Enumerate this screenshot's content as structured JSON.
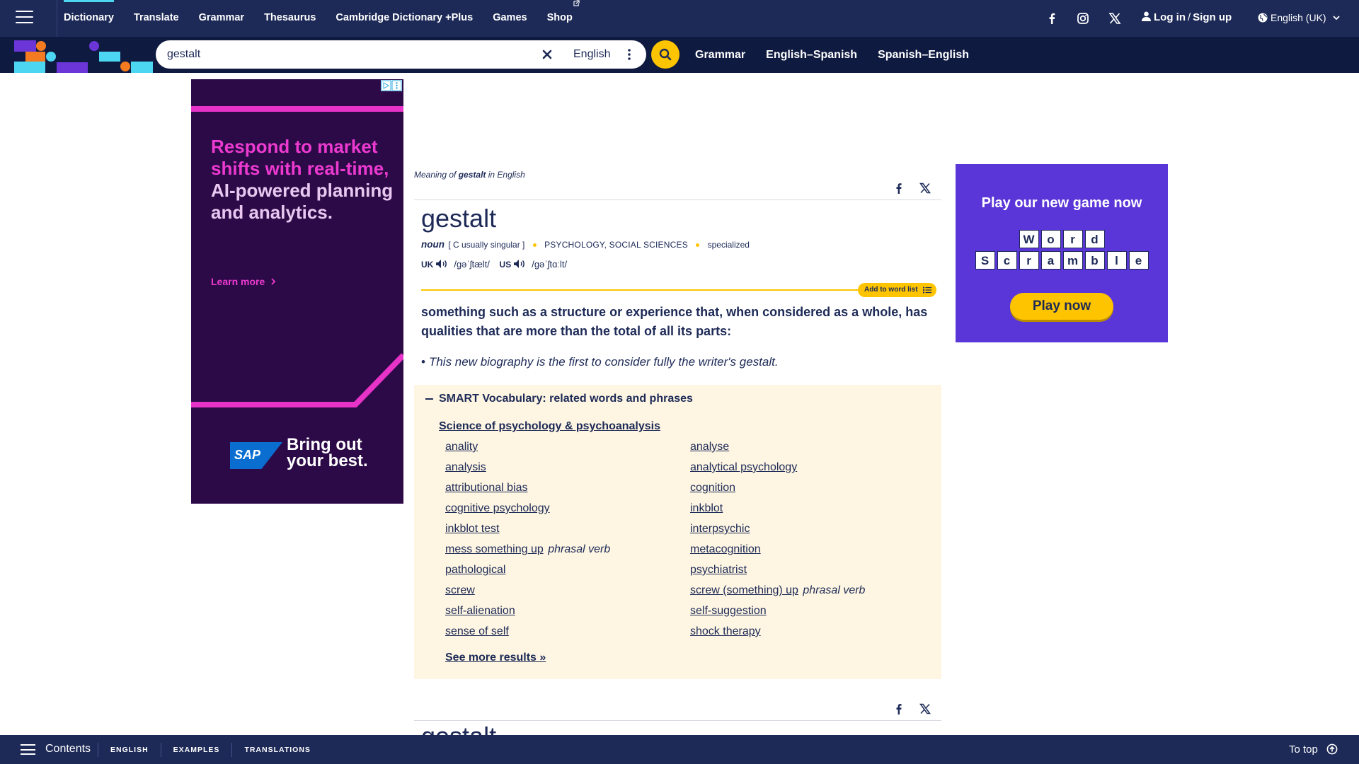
{
  "nav": {
    "items": [
      {
        "label": "Dictionary",
        "active": true
      },
      {
        "label": "Translate"
      },
      {
        "label": "Grammar"
      },
      {
        "label": "Thesaurus"
      },
      {
        "label": "Cambridge Dictionary +Plus"
      },
      {
        "label": "Games"
      },
      {
        "label": "Shop"
      }
    ],
    "login_label": "Log in",
    "slash": "/",
    "signup_label": "Sign up",
    "language": "English (UK)",
    "icons": [
      "menu-icon",
      "facebook-icon",
      "instagram-icon",
      "x-icon",
      "user-icon",
      "globe-icon",
      "chevron-down-icon",
      "external-link-icon"
    ]
  },
  "search": {
    "value": "gestalt",
    "dictionary": "English",
    "links": [
      "Grammar",
      "English–Spanish",
      "Spanish–English"
    ]
  },
  "ad_left": {
    "headline_1": "Respond to market shifts with real-time,",
    "headline_2": "AI-powered planning and analytics.",
    "learn_more": "Learn more",
    "brand": "SAP",
    "tagline_1": "Bring out",
    "tagline_2": "your best."
  },
  "ad_right": {
    "title": "Play our new game now",
    "row1": [
      "W",
      "o",
      "r",
      "d"
    ],
    "row2": [
      "S",
      "c",
      "r",
      "a",
      "m",
      "b",
      "l",
      "e"
    ],
    "button": "Play now"
  },
  "entry": {
    "meaning_prefix": "Meaning of ",
    "meaning_word": "gestalt",
    "meaning_suffix": " in English",
    "headword": "gestalt",
    "pos": "noun",
    "grammar": "[ C usually singular ]",
    "domain_1": "PSYCHOLOGY",
    "domain_sep": ", ",
    "domain_2": "SOCIAL SCIENCES",
    "usage": "specialized",
    "uk_label": "UK",
    "uk_ipa": "/ɡəˈʃtælt/",
    "us_label": "US",
    "us_ipa": "/ɡəˈʃtɑːlt/",
    "add_to_word_list": "Add to word list",
    "definition": "something such as a structure or experience that, when considered as a whole, has qualities that are more than the total of all its parts:",
    "example": "This new biography is the first to consider fully the writer's gestalt."
  },
  "smart_vocab": {
    "title": "SMART Vocabulary: related words and phrases",
    "topic": "Science of psychology & psychoanalysis",
    "col1": [
      {
        "word": "anality"
      },
      {
        "word": "analysis"
      },
      {
        "word": "attributional bias"
      },
      {
        "word": "cognitive psychology"
      },
      {
        "word": "inkblot test"
      },
      {
        "word": "mess something up",
        "note": "phrasal verb"
      },
      {
        "word": "pathological"
      },
      {
        "word": "screw"
      },
      {
        "word": "self-alienation"
      },
      {
        "word": "sense of self"
      }
    ],
    "col2": [
      {
        "word": "analyse"
      },
      {
        "word": "analytical psychology"
      },
      {
        "word": "cognition"
      },
      {
        "word": "inkblot"
      },
      {
        "word": "interpsychic"
      },
      {
        "word": "metacognition"
      },
      {
        "word": "psychiatrist"
      },
      {
        "word": "screw (something) up",
        "note": "phrasal verb"
      },
      {
        "word": "self-suggestion"
      },
      {
        "word": "shock therapy"
      }
    ],
    "see_more": "See more results »"
  },
  "entry2": {
    "headword": "gestalt"
  },
  "bottom": {
    "contents": "Contents",
    "tabs": [
      "ENGLISH",
      "EXAMPLES",
      "TRANSLATIONS"
    ],
    "to_top": "To top"
  },
  "colors": {
    "navy": "#1d2a57",
    "dark_navy": "#0f1a40",
    "yellow": "#fec400",
    "cyan": "#4dd6f2",
    "cream": "#fef6e2",
    "ad_purple": "#5a35d8"
  }
}
